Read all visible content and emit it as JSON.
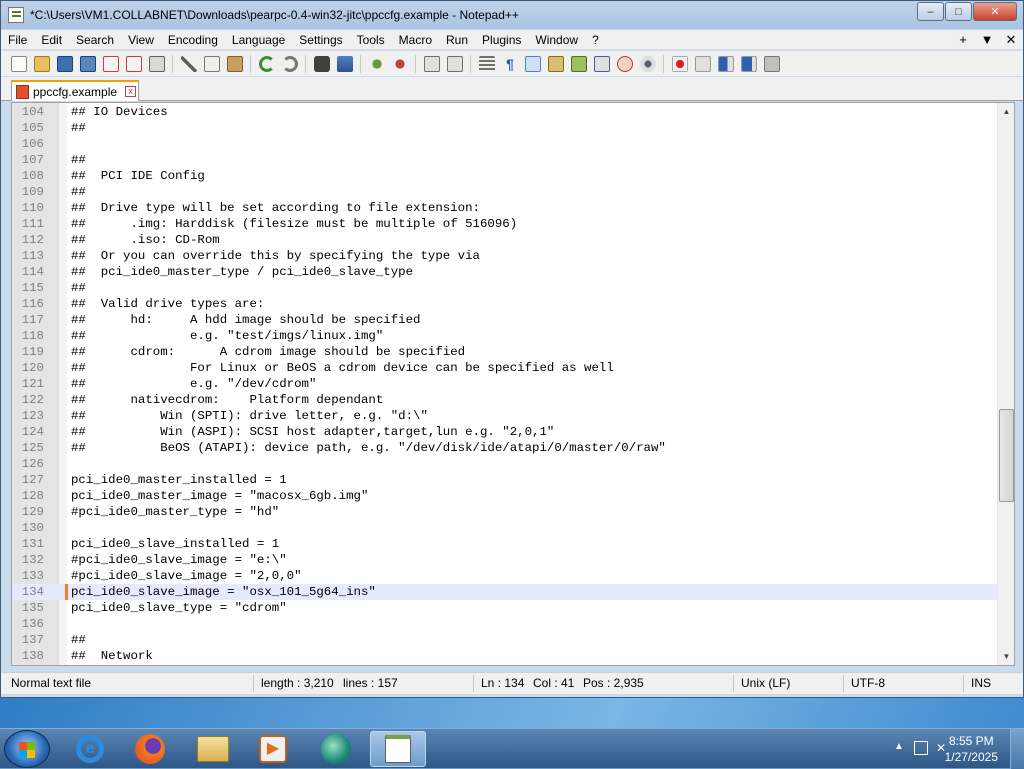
{
  "window": {
    "title": "*C:\\Users\\VM1.COLLABNET\\Downloads\\pearpc-0.4-win32-jitc\\ppccfg.example - Notepad++",
    "controls": {
      "minimize": "‒",
      "maximize": "□",
      "close": "✕"
    }
  },
  "menu": {
    "items": [
      "File",
      "Edit",
      "Search",
      "View",
      "Encoding",
      "Language",
      "Settings",
      "Tools",
      "Macro",
      "Run",
      "Plugins",
      "Window",
      "?"
    ],
    "right": [
      "+",
      "▼",
      "✕"
    ]
  },
  "toolbar": {
    "icons": [
      "new-file-icon",
      "open-file-icon",
      "save-icon",
      "save-all-icon",
      "close-icon",
      "close-all-icon",
      "print-icon",
      "cut-icon",
      "copy-icon",
      "paste-icon",
      "undo-icon",
      "redo-icon",
      "find-icon",
      "replace-icon",
      "zoom-in-icon",
      "zoom-out-icon",
      "sync-vertical-icon",
      "sync-horizontal-icon",
      "word-wrap-icon",
      "show-all-chars-icon",
      "indent-guide-icon",
      "doc-map-icon",
      "function-list-icon",
      "folder-workspace-icon",
      "monitoring-icon",
      "record-macro-icon",
      "stop-record-icon",
      "play-macro-icon",
      "run-macro-multiple-icon",
      "save-macro-icon"
    ]
  },
  "tab": {
    "label": "ppccfg.example",
    "close": "x"
  },
  "editor": {
    "current_line": 134,
    "lines": [
      {
        "n": "104",
        "text": "## IO Devices"
      },
      {
        "n": "105",
        "text": "##"
      },
      {
        "n": "106",
        "text": ""
      },
      {
        "n": "107",
        "text": "##"
      },
      {
        "n": "108",
        "text": "##  PCI IDE Config"
      },
      {
        "n": "109",
        "text": "##"
      },
      {
        "n": "110",
        "text": "##  Drive type will be set according to file extension:"
      },
      {
        "n": "111",
        "text": "##      .img: Harddisk (filesize must be multiple of 516096)"
      },
      {
        "n": "112",
        "text": "##      .iso: CD-Rom"
      },
      {
        "n": "113",
        "text": "##  Or you can override this by specifying the type via"
      },
      {
        "n": "114",
        "text": "##  pci_ide0_master_type / pci_ide0_slave_type"
      },
      {
        "n": "115",
        "text": "##"
      },
      {
        "n": "116",
        "text": "##  Valid drive types are:"
      },
      {
        "n": "117",
        "text": "##      hd:     A hdd image should be specified"
      },
      {
        "n": "118",
        "text": "##              e.g. \"test/imgs/linux.img\""
      },
      {
        "n": "119",
        "text": "##      cdrom:      A cdrom image should be specified"
      },
      {
        "n": "120",
        "text": "##              For Linux or BeOS a cdrom device can be specified as well"
      },
      {
        "n": "121",
        "text": "##              e.g. \"/dev/cdrom\""
      },
      {
        "n": "122",
        "text": "##      nativecdrom:    Platform dependant"
      },
      {
        "n": "123",
        "text": "##          Win (SPTI): drive letter, e.g. \"d:\\\""
      },
      {
        "n": "124",
        "text": "##          Win (ASPI): SCSI host adapter,target,lun e.g. \"2,0,1\""
      },
      {
        "n": "125",
        "text": "##          BeOS (ATAPI): device path, e.g. \"/dev/disk/ide/atapi/0/master/0/raw\""
      },
      {
        "n": "126",
        "text": ""
      },
      {
        "n": "127",
        "text": "pci_ide0_master_installed = 1"
      },
      {
        "n": "128",
        "text": "pci_ide0_master_image = \"macosx_6gb.img\""
      },
      {
        "n": "129",
        "text": "#pci_ide0_master_type = \"hd\""
      },
      {
        "n": "130",
        "text": ""
      },
      {
        "n": "131",
        "text": "pci_ide0_slave_installed = 1"
      },
      {
        "n": "132",
        "text": "#pci_ide0_slave_image = \"e:\\\""
      },
      {
        "n": "133",
        "text": "#pci_ide0_slave_image = \"2,0,0\""
      },
      {
        "n": "134",
        "text": "pci_ide0_slave_image = \"osx_101_5g64_ins\""
      },
      {
        "n": "135",
        "text": "pci_ide0_slave_type = \"cdrom\""
      },
      {
        "n": "136",
        "text": ""
      },
      {
        "n": "137",
        "text": "##"
      },
      {
        "n": "138",
        "text": "##  Network"
      }
    ]
  },
  "status": {
    "file_type": "Normal text file",
    "length": "length : 3,210",
    "lines": "lines : 157",
    "ln": "Ln : 134",
    "col": "Col : 41",
    "pos": "Pos : 2,935",
    "eol": "Unix (LF)",
    "encoding": "UTF-8",
    "mode": "INS"
  },
  "taskbar": {
    "apps": [
      "internet-explorer-icon",
      "firefox-icon",
      "file-explorer-icon",
      "media-player-icon",
      "remote-app-icon",
      "notepad-plus-plus-icon"
    ],
    "time": "8:55 PM",
    "date": "1/27/2025"
  },
  "colors": {
    "accent_tab": "#f0a000",
    "current_line_bg": "#e8e8ff",
    "caret_marker": "#f08020"
  }
}
